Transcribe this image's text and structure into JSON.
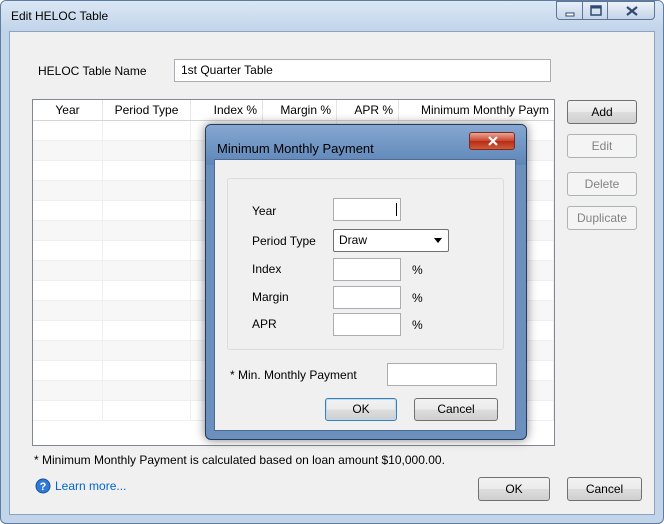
{
  "window": {
    "title": "Edit HELOC Table",
    "controls": {
      "minimize": "minimize-icon",
      "maximize": "maximize-icon",
      "close": "close-icon"
    }
  },
  "form": {
    "name_label": "HELOC Table Name",
    "name_value": "1st Quarter Table"
  },
  "grid": {
    "columns": [
      "Year",
      "Period Type",
      "Index %",
      "Margin %",
      "APR %",
      "Minimum Monthly Paym"
    ],
    "row_count": 15
  },
  "side_buttons": [
    {
      "label": "Add",
      "enabled": true
    },
    {
      "label": "Edit",
      "enabled": false
    },
    {
      "label": "Delete",
      "enabled": false
    },
    {
      "label": "Duplicate",
      "enabled": false
    }
  ],
  "footnote": "* Minimum Monthly Payment is calculated based on loan amount $10,000.00.",
  "help": {
    "icon": "help-icon",
    "link": "Learn more..."
  },
  "footer": {
    "ok": "OK",
    "cancel": "Cancel"
  },
  "dialog": {
    "title": "Minimum Monthly Payment",
    "fields": {
      "year_label": "Year",
      "year_value": "",
      "period_type_label": "Period Type",
      "period_type_value": "Draw",
      "index_label": "Index",
      "index_value": "",
      "margin_label": "Margin",
      "margin_value": "",
      "apr_label": "APR",
      "apr_value": "",
      "percent": "%",
      "min_payment_label": "* Min. Monthly Payment",
      "min_payment_value": ""
    },
    "ok": "OK",
    "cancel": "Cancel"
  },
  "colors": {
    "frame": "#c1d4ea",
    "link": "#0066cc",
    "dialog_frame": "#6b90be",
    "close_red": "#c9452f"
  }
}
